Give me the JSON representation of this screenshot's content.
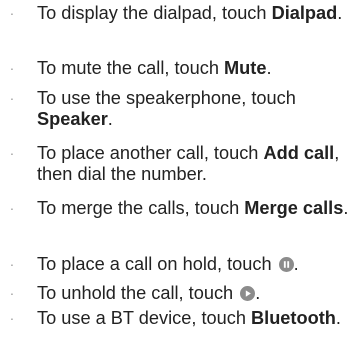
{
  "bullet_char": "·",
  "items": [
    {
      "pre": "To display the dialpad, touch ",
      "bold": "Dialpad",
      "post": "."
    },
    {
      "pre": "To mute the call, touch ",
      "bold": "Mute",
      "post": "."
    },
    {
      "pre": "To use the speakerphone, touch ",
      "bold": "Speaker",
      "post": "."
    },
    {
      "pre": "To place another call, touch ",
      "bold": "Add call",
      "post": ", then dial the number."
    },
    {
      "pre": "To merge the calls, touch ",
      "bold": "Merge calls",
      "post": "."
    },
    {
      "pre": "To place a call on hold, touch ",
      "icon": "pause-icon",
      "post": "."
    },
    {
      "pre": "To unhold the call, touch ",
      "icon": "play-icon",
      "post": "."
    },
    {
      "pre": "To use a BT device, touch ",
      "bold": "Bluetooth",
      "post": "."
    }
  ],
  "colors": {
    "text": "#222222",
    "bullet": "#9a9a9a",
    "icon_fill": "#8c8c8c"
  }
}
